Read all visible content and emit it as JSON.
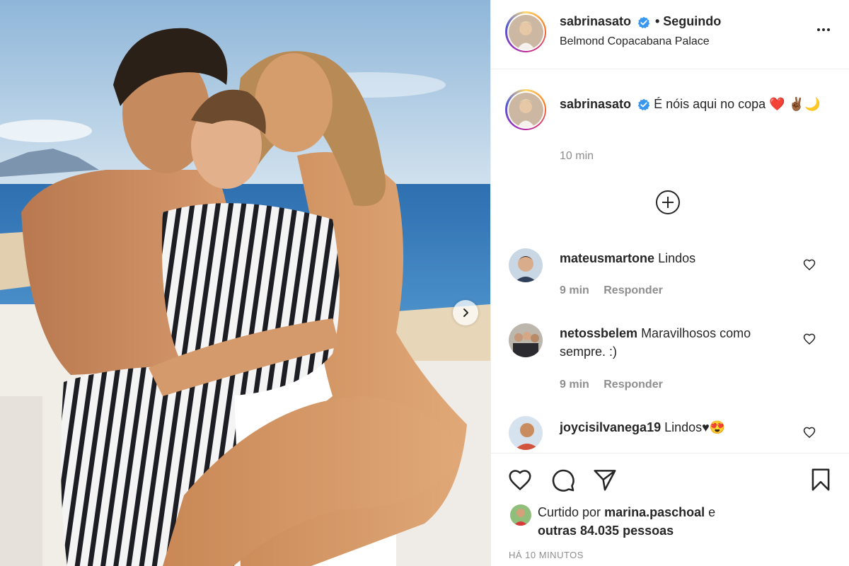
{
  "post": {
    "author": {
      "username": "sabrinasato",
      "verified_icon": "verified-badge-icon",
      "follow_status": "• Seguindo",
      "location": "Belmond Copacabana Palace"
    },
    "caption": {
      "username": "sabrinasato",
      "text": "É nóis aqui no copa",
      "emoji": "❤️ ✌🏾🌙",
      "time": "10 min"
    },
    "load_more_icon": "plus-circle-icon",
    "comments": [
      {
        "username": "mateusmartone",
        "text": "Lindos",
        "time": "9 min",
        "reply": "Responder"
      },
      {
        "username": "netossbelem",
        "text": "Maravilhosos como sempre. :)",
        "time": "9 min",
        "reply": "Responder"
      },
      {
        "username": "joycisilvanega19",
        "text": "Lindos♥😍"
      }
    ],
    "likes": {
      "prefix": "Curtido por",
      "user": "marina.paschoal",
      "suffix": "e",
      "others": "outras 84.035 pessoas"
    },
    "timestamp": "HÁ 10 MINUTOS"
  },
  "colors": {
    "verified": "#3897f0",
    "border": "#efefef",
    "muted": "#8e8e8e",
    "heart_red": "#ed4956"
  }
}
